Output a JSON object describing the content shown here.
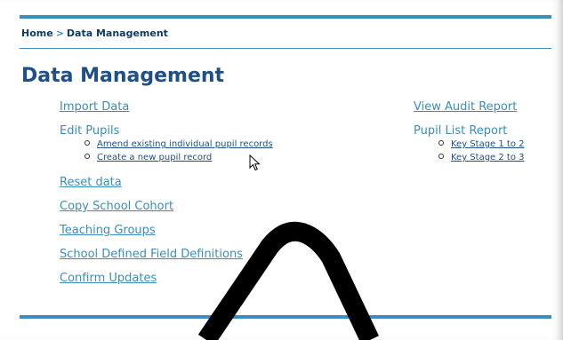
{
  "breadcrumb": {
    "home": "Home",
    "separator": ">",
    "current": "Data Management"
  },
  "page_title": "Data Management",
  "left_menu": {
    "import_data": "Import Data",
    "edit_pupils": "Edit Pupils",
    "edit_pupils_sub": [
      "Amend existing individual pupil records",
      "Create a new pupil record"
    ],
    "reset_data": "Reset data",
    "copy_school_cohort": "Copy School Cohort",
    "teaching_groups": "Teaching Groups",
    "school_defined_fields": "School Defined Field Definitions",
    "confirm_updates": "Confirm Updates"
  },
  "right_menu": {
    "view_audit_report": "View Audit Report",
    "pupil_list_report": "Pupil List Report",
    "pupil_list_sub": [
      "Key Stage 1 to 2",
      "Key Stage 2 to 3"
    ]
  },
  "colors": {
    "accent": "#3b8dbd",
    "heading": "#1e4f86",
    "breadcrumb": "#103c63"
  }
}
